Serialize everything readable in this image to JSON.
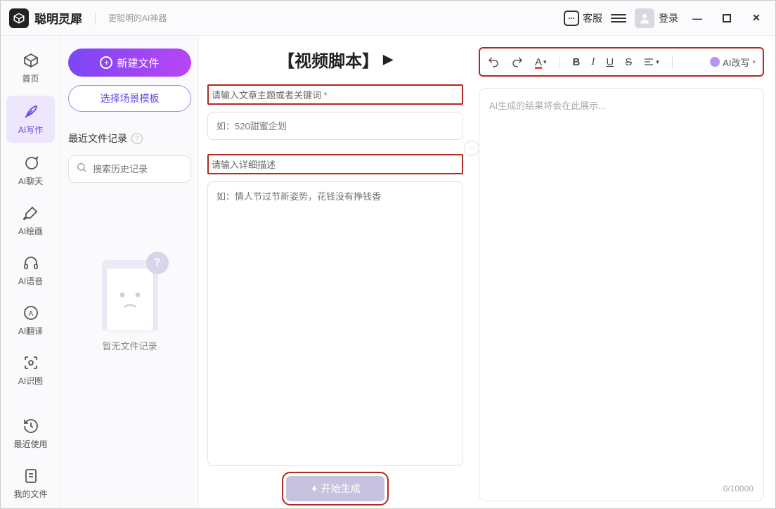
{
  "titlebar": {
    "app_name": "聪明灵犀",
    "app_subtitle": "更聪明的AI神器",
    "kefu_label": "客服",
    "login_label": "登录"
  },
  "nav": {
    "items": [
      {
        "label": "首页"
      },
      {
        "label": "AI写作"
      },
      {
        "label": "AI聊天"
      },
      {
        "label": "AI绘画"
      },
      {
        "label": "AI语音"
      },
      {
        "label": "AI翻译"
      },
      {
        "label": "AI识图"
      }
    ],
    "recent_label": "最近使用",
    "myfiles_label": "我的文件"
  },
  "filecol": {
    "new_file_label": "新建文件",
    "scene_template_label": "选择场景模板",
    "recent_files_label": "最近文件记录",
    "search_placeholder": "搜索历史记录",
    "empty_label": "暂无文件记录"
  },
  "center": {
    "title": "【视频脚本】",
    "topic_label": "请输入文章主题或者关键词",
    "topic_placeholder": "如：520甜蜜企划",
    "desc_label": "请输入详细描述",
    "desc_placeholder": "如：情人节过节新姿势，花钱没有挣钱香",
    "generate_label": "✦ 开始生成"
  },
  "right": {
    "toolbar": {
      "undo": "↶",
      "redo": "↷",
      "font": "A",
      "bold": "B",
      "italic": "I",
      "underline": "U",
      "strike": "S",
      "align": "≡",
      "rewrite_label": "AI改写"
    },
    "placeholder": "AI生成的结果将会在此展示...",
    "counter": "0/10000"
  }
}
